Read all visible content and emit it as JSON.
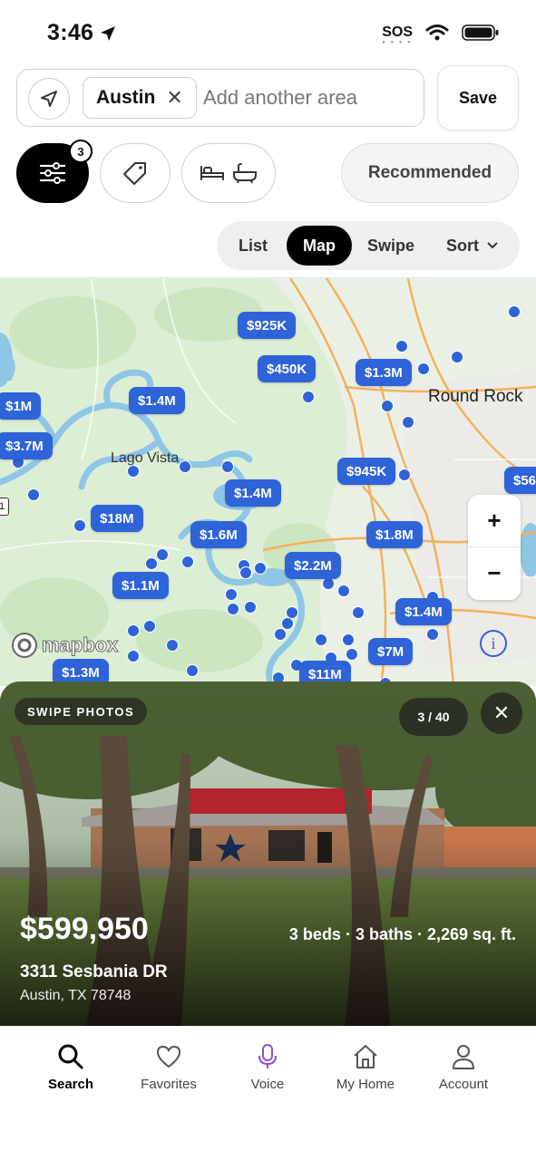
{
  "status_bar": {
    "time": "3:46",
    "sos": "SOS"
  },
  "search": {
    "chip_label": "Austin",
    "placeholder": "Add another area",
    "save_label": "Save"
  },
  "filters": {
    "badge_count": "3",
    "sort_option": "Recommended"
  },
  "view_toggle": {
    "list": "List",
    "map": "Map",
    "swipe": "Swipe",
    "sort": "Sort",
    "active": "Map"
  },
  "map": {
    "place_labels": {
      "round_rock": "Round Rock",
      "lago_vista": "Lago Vista",
      "attribution": "mapbox"
    },
    "price_pins": [
      "$925K",
      "$450K",
      "$1.3M",
      "$1M",
      "$1.4M",
      "$3.7M",
      "$945K",
      "$56",
      "$1.4M",
      "$18M",
      "$1.6M",
      "$1.8M",
      "$2.2M",
      "$1.1M",
      "$1.4M",
      "$7M",
      "$1.3M",
      "$11M"
    ],
    "edge_marker": "1",
    "zoom_in": "+",
    "zoom_out": "−"
  },
  "listing": {
    "swipe_hint": "SWIPE PHOTOS",
    "photo_counter": "3 / 40",
    "price": "$599,950",
    "specs": "3 beds · 3 baths · 2,269 sq. ft.",
    "street": "3311 Sesbania DR",
    "city": "Austin, TX 78748"
  },
  "nav": [
    {
      "label": "Search",
      "icon": "search-icon"
    },
    {
      "label": "Favorites",
      "icon": "heart-icon"
    },
    {
      "label": "Voice",
      "icon": "microphone-icon"
    },
    {
      "label": "My Home",
      "icon": "home-icon"
    },
    {
      "label": "Account",
      "icon": "person-icon"
    }
  ],
  "colors": {
    "pin_blue": "#2f63d8",
    "voice_purple": "#8a4fd8",
    "map_green": "#d9ecd2",
    "water": "#8fc6e6",
    "road_orange": "#f2b25c"
  }
}
